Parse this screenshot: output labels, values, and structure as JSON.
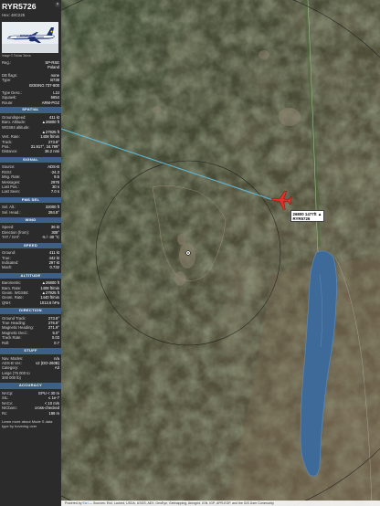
{
  "header": {
    "callsign": "RYR5726",
    "hex_label": "Hex:",
    "hex": "48C225",
    "close_glyph": "×"
  },
  "photo": {
    "credit": "Image © Tobias Talma"
  },
  "info": [
    {
      "k": "Reg.:",
      "v": "SP-RSE"
    },
    {
      "k": "",
      "v": "Poland"
    },
    {
      "k": "DB flags:",
      "v": "none"
    },
    {
      "k": "Type:",
      "v": "B738"
    },
    {
      "k": "",
      "v": "BOEING 737-800"
    },
    {
      "k": "Type Desc.:",
      "v": "L2J"
    },
    {
      "k": "Squawk:",
      "v": "5654"
    },
    {
      "k": "Route:",
      "v": "ARM-POZ"
    }
  ],
  "sections": [
    {
      "title": "SPATIAL",
      "rows": [
        {
          "k": "Groundspeed:",
          "v": "411 kt"
        },
        {
          "k": "Baro. Altitude:",
          "v": "▲26800 ft"
        },
        {
          "k": "WGS84 altitude:",
          "v": ""
        },
        {
          "k": "",
          "v": "▲27925 ft"
        },
        {
          "k": "Vert. Rate:",
          "v": "1408 ft/min"
        },
        {
          "k": "Track:",
          "v": "273.8°"
        },
        {
          "k": "Pos.:",
          "v": "31.917°, 34.799°"
        },
        {
          "k": "Distance:",
          "v": "36.2 nmi"
        }
      ]
    },
    {
      "title": "SIGNAL",
      "rows": [
        {
          "k": "Source:",
          "v": "ADS-B"
        },
        {
          "k": "RSSI:",
          "v": "-24.3"
        },
        {
          "k": "Msg. Rate:",
          "v": "9.5"
        },
        {
          "k": "Messages:",
          "v": "2976"
        },
        {
          "k": "Last Pos.:",
          "v": "30 s"
        },
        {
          "k": "Last Seen:",
          "v": "7.0 s"
        }
      ]
    },
    {
      "title": "FMS SEL",
      "rows": [
        {
          "k": "Sel. Alt.:",
          "v": "32000 ft"
        },
        {
          "k": "Sel. Head.:",
          "v": "284.8°"
        }
      ]
    },
    {
      "title": "WIND",
      "rows": [
        {
          "k": "Speed:",
          "v": "36 kt"
        },
        {
          "k": "Direction (from):",
          "v": "308°"
        },
        {
          "k": "TAT / OAT:",
          "v": "-5 / -30 °C"
        }
      ]
    },
    {
      "title": "SPEED",
      "rows": [
        {
          "k": "Ground:",
          "v": "411 kt"
        },
        {
          "k": "True:",
          "v": "442 kt"
        },
        {
          "k": "Indicated:",
          "v": "297 kt"
        },
        {
          "k": "Mach:",
          "v": "0.732"
        }
      ]
    },
    {
      "title": "ALTITUDE",
      "rows": [
        {
          "k": "Barometric:",
          "v": "▲26800 ft"
        },
        {
          "k": "Baro. Rate:",
          "v": "1408 ft/min"
        },
        {
          "k": "Geom. WGS84:",
          "v": "▲27925 ft"
        },
        {
          "k": "Geom. Rate:",
          "v": "1440 ft/min"
        },
        {
          "k": "QNH:",
          "v": "1013.6 hPa"
        }
      ]
    },
    {
      "title": "DIRECTION",
      "rows": [
        {
          "k": "Ground Track:",
          "v": "273.8°"
        },
        {
          "k": "True Heading:",
          "v": "276.8°"
        },
        {
          "k": "Magnetic Heading:",
          "v": "271.9°"
        },
        {
          "k": "Magnetic Decl.:",
          "v": "5.0°"
        },
        {
          "k": "Track Rate:",
          "v": "0.03"
        },
        {
          "k": "Roll:",
          "v": "0.7"
        }
      ]
    },
    {
      "title": "STUFF",
      "rows": [
        {
          "k": "Nav. Modes:",
          "v": "n/a"
        },
        {
          "k": "ADS-B Ver.:",
          "v": "v2 (DO-260B)"
        },
        {
          "k": "Category:",
          "v": "A3"
        },
        {
          "k": "Large (75 000 to",
          "v": ""
        },
        {
          "k": "300 000 lb)",
          "v": ""
        }
      ]
    },
    {
      "title": "ACCURACY",
      "rows": [
        {
          "k": "NACp:",
          "v": "EPU < 30 m"
        },
        {
          "k": "SIL:",
          "v": "≤ 1e-7"
        },
        {
          "k": "NACv:",
          "v": "< 10 m/s"
        },
        {
          "k": "NICbaro:",
          "v": "cross-checked"
        },
        {
          "k": "Rc:",
          "v": "186 m"
        }
      ]
    }
  ],
  "footer": "Learn more about Mode S data type by hovering over",
  "map": {
    "aircraft_label_line1": "26800 1477ft ▲",
    "aircraft_label_line2": "RYR5726",
    "attribution_prefix": "Powered by",
    "attribution_link": "Esri",
    "attribution_rest": "— Sources: Esri, i-cubed, USDA, USGS, AEX, GeoEye, Getmapping, Aerogrid, IGN, IGP, UPR-EGP, and the GIS User Community",
    "scale_label": "",
    "colors": {
      "aircraft": "#e8302a",
      "track": "#5fb8d6",
      "range_ring": "#1a1a1a",
      "sea": "#3e6a9a",
      "section_header": "#3e5f86"
    }
  }
}
